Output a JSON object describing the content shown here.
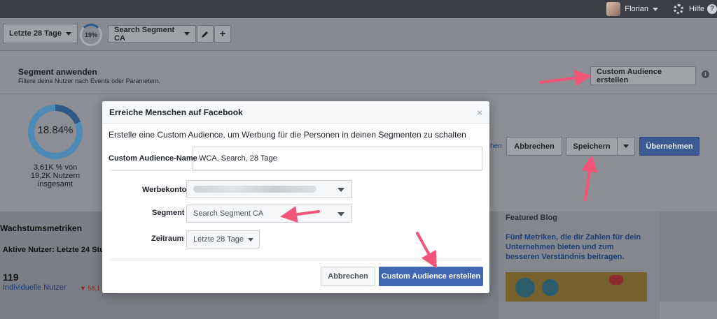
{
  "topbar": {
    "user_name": "Florian",
    "help_label": "Hilfe",
    "help_badge": "?"
  },
  "toolbar": {
    "date_range": "Letzte 28 Tage",
    "percent": "19%",
    "segment": "Search Segment CA",
    "add_symbol": "+"
  },
  "segment_panel": {
    "title": "Segment anwenden",
    "subtitle": "Filtere deine Nutzer nach Events oder Parametern.",
    "create_audience_button": "Custom Audience erstellen",
    "info_badge": "i",
    "donut_percent": "18.84%",
    "donut_fraction": 0.1884,
    "caption_line1": "3,61K % von",
    "caption_line2": "19,2K Nutzern",
    "caption_line3": "insgesamt",
    "link_fragment": "hen",
    "cancel_label": "Abbrechen",
    "save_label": "Speichern",
    "apply_label": "Übernehmen"
  },
  "metrics": {
    "title": "Wachstumsmetriken",
    "active_users": "Aktive Nutzer: Letzte 24 Stu",
    "value": "119",
    "value_label": "Individuelle Nutzer",
    "delta": "▼ 58,1"
  },
  "blog": {
    "title": "Featured Blog",
    "text": "Fünf Metriken, die dir Zahlen für dein Unternehmen bieten und zum besseren Verständnis beitragen."
  },
  "modal": {
    "title": "Erreiche Menschen auf Facebook",
    "close_symbol": "×",
    "description": "Erstelle eine Custom Audience, um Werbung für die Personen in deinen Segmenten zu schalten",
    "name_label": "Custom Audience-Name",
    "name_value": "WCA, Search, 28 Tage",
    "account_label": "Werbekonto",
    "segment_label": "Segment",
    "segment_value": "Search Segment CA",
    "period_label": "Zeitraum",
    "period_value": "Letzte 28 Tage",
    "cancel_label": "Abbrechen",
    "create_label": "Custom Audience erstellen"
  },
  "colors": {
    "annotation_arrow": "#f2557a",
    "primary_button": "#4267b2"
  }
}
